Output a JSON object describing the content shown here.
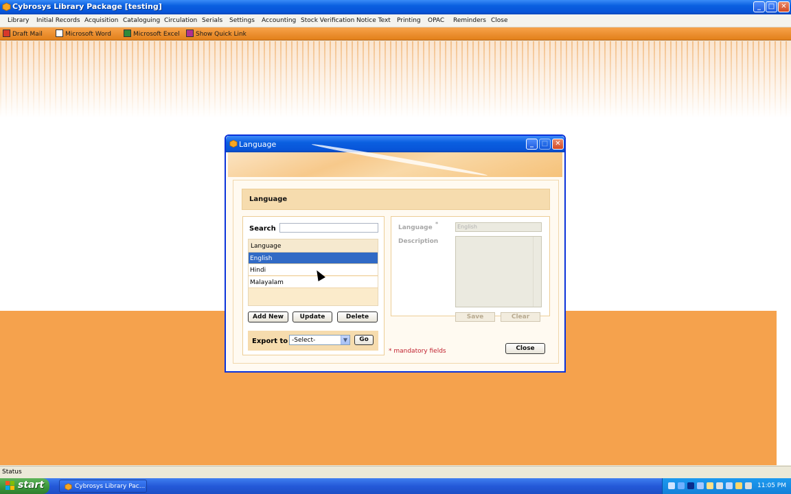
{
  "app": {
    "title": "Cybrosys Library Package [testing]",
    "minimize": "_",
    "maximize": "□",
    "close": "✕"
  },
  "menu": {
    "items": [
      "Library",
      "Initial Records",
      "Acquisition",
      "Cataloguing",
      "Circulation",
      "Serials",
      "Settings",
      "Accounting",
      "Stock Verification",
      "Notice Text",
      "Printing",
      "OPAC",
      "Reminders",
      "Close"
    ]
  },
  "quickbar": {
    "items": [
      "Draft Mail",
      "Microsoft Word",
      "Microsoft Excel",
      "Show Quick Link"
    ]
  },
  "dialog": {
    "title": "Language",
    "header": "Language",
    "search_label": "Search",
    "search_value": "",
    "grid": {
      "column": "Language",
      "rows": [
        "English",
        "Hindi",
        "Malayalam"
      ],
      "selected": "English"
    },
    "buttons": {
      "add_new": "Add New",
      "update": "Update",
      "delete": "Delete",
      "go": "Go",
      "save": "Save",
      "clear": "Clear",
      "close": "Close"
    },
    "export_label": "Export to",
    "export_select": "-Select-",
    "form": {
      "language_label": "Language",
      "required_mark": "*",
      "language_value": "English",
      "description_label": "Description",
      "description_value": ""
    },
    "mandatory_note": "* mandatory fields"
  },
  "status": {
    "text": "Status"
  },
  "taskbar": {
    "start": "start",
    "task_item": "Cybrosys Library Pac...",
    "clock": "11:05 PM"
  },
  "colors": {
    "accent_orange": "#f5a24d",
    "selection_blue": "#316ac5",
    "title_blue": "#0a5fe0",
    "mandatory_red": "#c0202f"
  }
}
